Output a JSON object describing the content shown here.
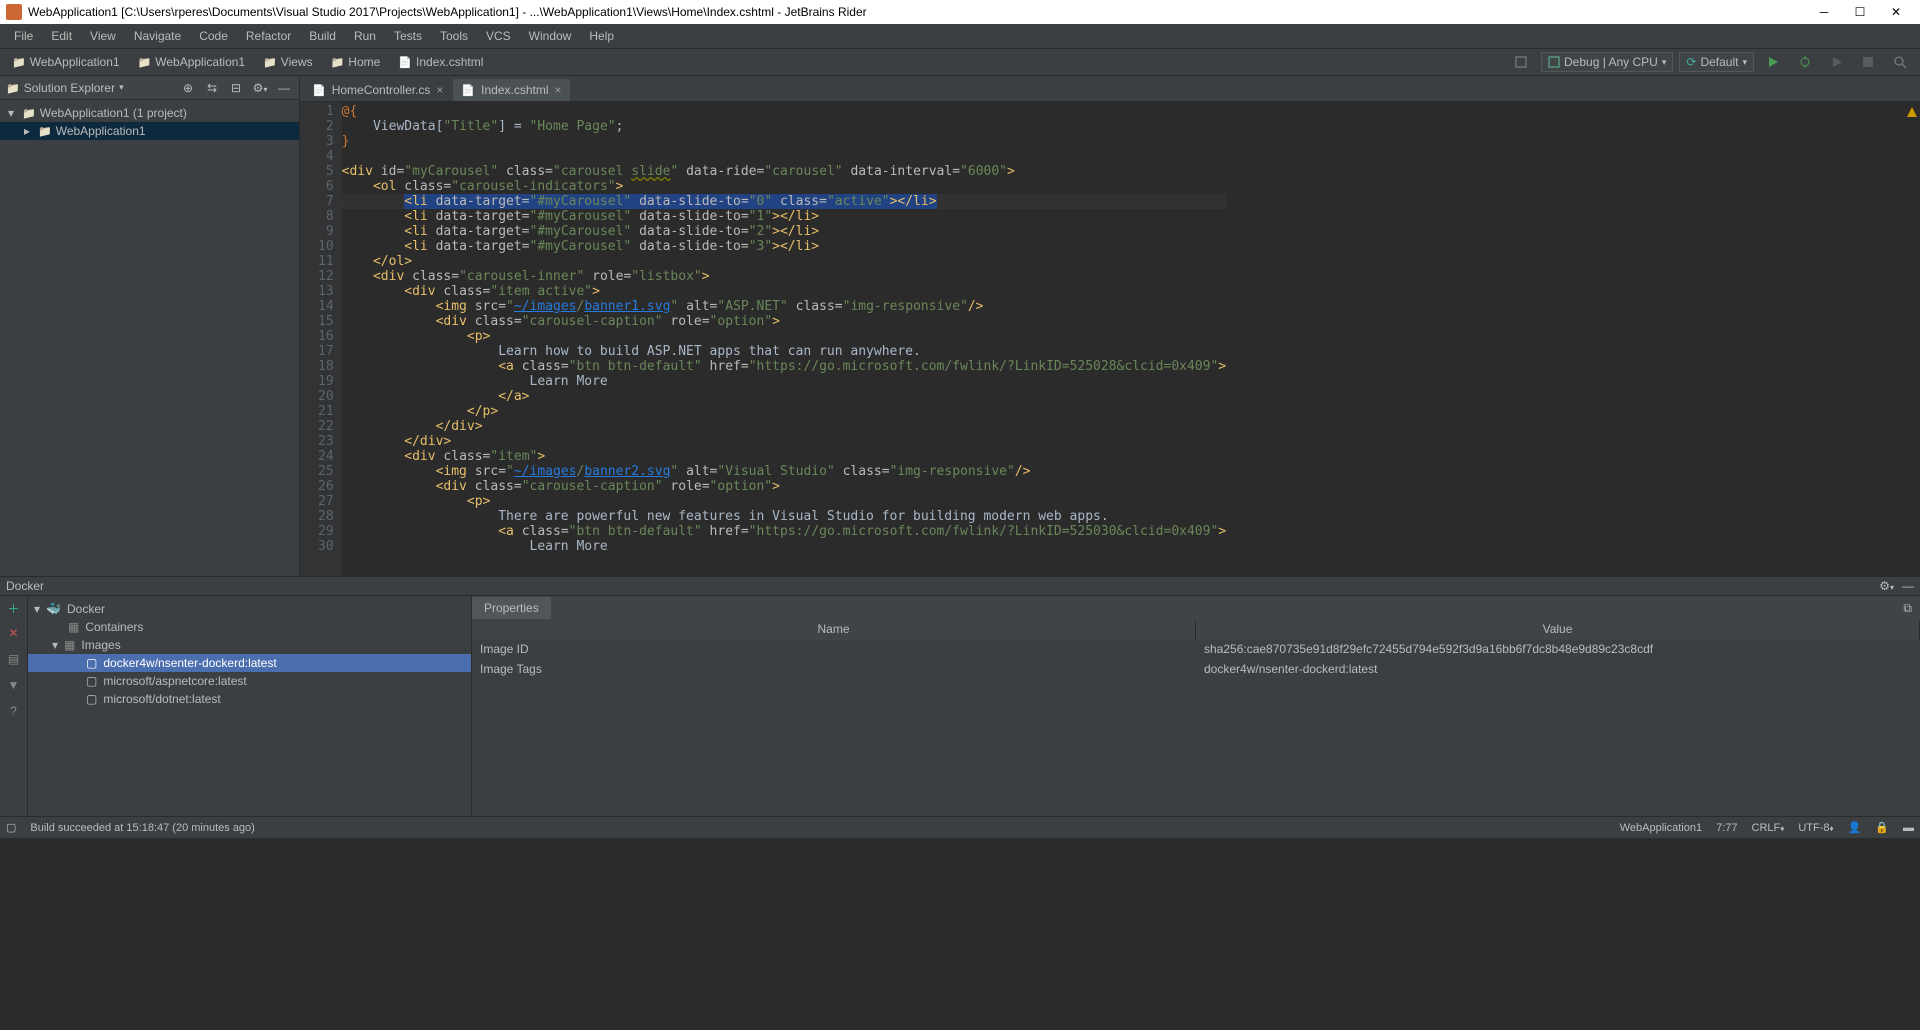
{
  "title": "WebApplication1 [C:\\Users\\rperes\\Documents\\Visual Studio 2017\\Projects\\WebApplication1] - ...\\WebApplication1\\Views\\Home\\Index.cshtml - JetBrains Rider",
  "menu": [
    "File",
    "Edit",
    "View",
    "Navigate",
    "Code",
    "Refactor",
    "Build",
    "Run",
    "Tests",
    "Tools",
    "VCS",
    "Window",
    "Help"
  ],
  "breadcrumb": [
    "WebApplication1",
    "WebApplication1",
    "Views",
    "Home",
    "Index.cshtml"
  ],
  "toolbar": {
    "run_config": "Debug | Any CPU",
    "solution_config": "Default"
  },
  "explorer": {
    "title": "Solution Explorer",
    "root": "WebApplication1 (1 project)",
    "child": "WebApplication1"
  },
  "tabs": [
    {
      "label": "HomeController.cs",
      "active": false
    },
    {
      "label": "Index.cshtml",
      "active": true
    }
  ],
  "code": {
    "lines": [
      1,
      2,
      3,
      4,
      5,
      6,
      7,
      8,
      9,
      10,
      11,
      12,
      13,
      14,
      15,
      16,
      17,
      18,
      19,
      20,
      21,
      22,
      23,
      24,
      25,
      26,
      27,
      28,
      29,
      30
    ]
  },
  "docker": {
    "title": "Docker",
    "root": "Docker",
    "containers": "Containers",
    "images": "Images",
    "image_list": [
      "docker4w/nsenter-dockerd:latest",
      "microsoft/aspnetcore:latest",
      "microsoft/dotnet:latest"
    ],
    "props_tab": "Properties",
    "cols": [
      "Name",
      "Value"
    ],
    "rows": [
      {
        "name": "Image ID",
        "value": "sha256:cae870735e91d8f29efc72455d794e592f3d9a16bb6f7dc8b48e9d89c23c8cdf"
      },
      {
        "name": "Image Tags",
        "value": "docker4w/nsenter-dockerd:latest"
      }
    ]
  },
  "status": {
    "build": "Build succeeded at 15:18:47 (20 minutes ago)",
    "project": "WebApplication1",
    "cursor": "7:77",
    "eol": "CRLF",
    "encoding": "UTF-8"
  }
}
